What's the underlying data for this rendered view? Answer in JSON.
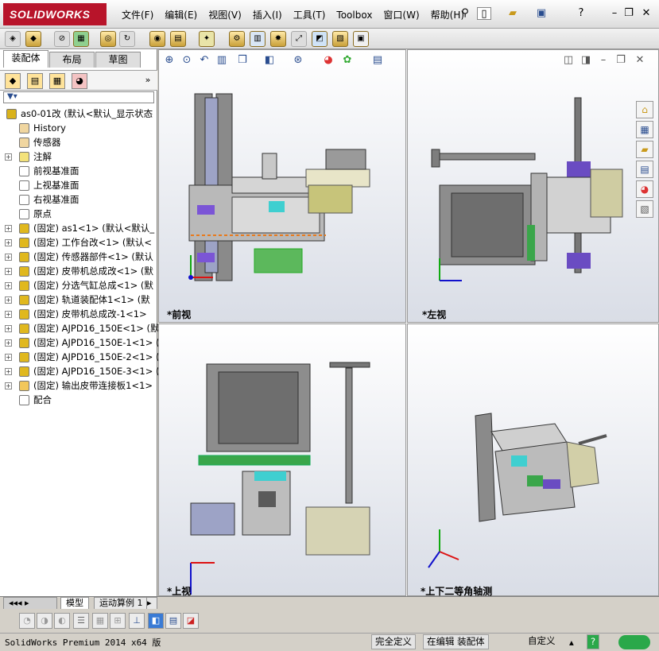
{
  "app": {
    "brand": "SOLIDWORKS"
  },
  "menubar": [
    "文件(F)",
    "编辑(E)",
    "视图(V)",
    "插入(I)",
    "工具(T)",
    "Toolbox",
    "窗口(W)",
    "帮助(H)"
  ],
  "sidebar": {
    "tabs": [
      "装配体",
      "布局",
      "草图"
    ],
    "active_tab": "装配体",
    "tree": [
      {
        "label": "as0-01改  (默认<默认_显示状态",
        "expand": "",
        "icon": "assembly"
      },
      {
        "label": "History",
        "expand": "",
        "icon": "history"
      },
      {
        "label": "传感器",
        "expand": "",
        "icon": "sensor"
      },
      {
        "label": "注解",
        "expand": "+",
        "icon": "annotation"
      },
      {
        "label": "前视基准面",
        "expand": "",
        "icon": "plane"
      },
      {
        "label": "上视基准面",
        "expand": "",
        "icon": "plane"
      },
      {
        "label": "右视基准面",
        "expand": "",
        "icon": "plane"
      },
      {
        "label": "原点",
        "expand": "",
        "icon": "origin"
      },
      {
        "label": "(固定) as1<1> (默认<默认_",
        "expand": "+",
        "icon": "subassembly"
      },
      {
        "label": "(固定) 工作台改<1> (默认<",
        "expand": "+",
        "icon": "subassembly"
      },
      {
        "label": "(固定) 传感器部件<1> (默认",
        "expand": "+",
        "icon": "subassembly"
      },
      {
        "label": "(固定) 皮带机总成改<1> (默",
        "expand": "+",
        "icon": "subassembly"
      },
      {
        "label": "(固定) 分选气缸总成<1> (默",
        "expand": "+",
        "icon": "subassembly"
      },
      {
        "label": "(固定) 轨道装配体1<1> (默",
        "expand": "+",
        "icon": "subassembly"
      },
      {
        "label": "(固定) 皮带机总成改-1<1>",
        "expand": "+",
        "icon": "subassembly"
      },
      {
        "label": "(固定) AJPD16_150E<1> (默",
        "expand": "+",
        "icon": "subassembly"
      },
      {
        "label": "(固定) AJPD16_150E-1<1> (",
        "expand": "+",
        "icon": "subassembly"
      },
      {
        "label": "(固定) AJPD16_150E-2<1> (",
        "expand": "+",
        "icon": "subassembly"
      },
      {
        "label": "(固定) AJPD16_150E-3<1> (",
        "expand": "+",
        "icon": "subassembly"
      },
      {
        "label": "(固定) 输出皮带连接板1<1>",
        "expand": "+",
        "icon": "subassembly-yellow"
      },
      {
        "label": "配合",
        "expand": "",
        "icon": "mate"
      }
    ]
  },
  "views": {
    "front": "*前视",
    "left": "*左视",
    "top": "*上视",
    "iso": "*上下二等角轴测"
  },
  "bottom_tabs": [
    "模型",
    "运动算例 1"
  ],
  "status": {
    "product": "SolidWorks Premium 2014 x64 版",
    "definition": "完全定义",
    "mode": "在编辑 装配体",
    "custom": "自定义",
    "help": "?"
  },
  "colors": {
    "brand": "#b8142a",
    "part_gray": "#7d7d7d",
    "part_green": "#3aa64a",
    "part_purple": "#6a4cc2",
    "part_cyan": "#3fcfd0",
    "axis_red": "#d11",
    "axis_green": "#1a1",
    "axis_blue": "#11c"
  }
}
